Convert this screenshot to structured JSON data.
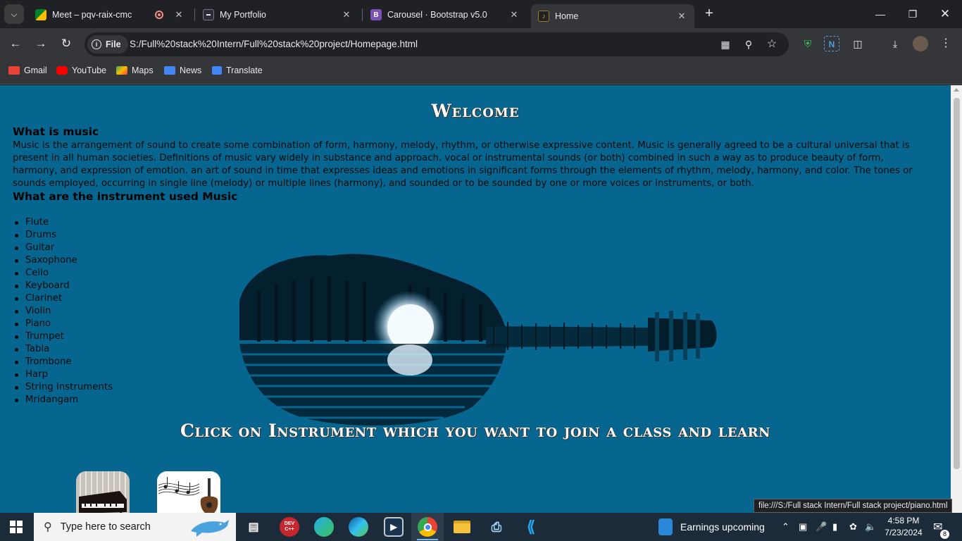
{
  "browser": {
    "tabs": [
      {
        "title": "Meet – pqv-raix-cmc",
        "favicon": "google-meet-icon",
        "recording": true
      },
      {
        "title": "My Portfolio",
        "favicon": "portfolio-icon"
      },
      {
        "title": "Carousel · Bootstrap v5.0",
        "favicon": "bootstrap-icon",
        "favicon_text": "B"
      },
      {
        "title": "Home",
        "favicon": "guitar-icon",
        "active": true
      }
    ],
    "url_chip": "File",
    "url": "S:/Full%20stack%20Intern/Full%20stack%20project/Homepage.html",
    "bookmarks": [
      {
        "label": "Gmail",
        "color": "#ea4335"
      },
      {
        "label": "YouTube",
        "color": "#ff0000"
      },
      {
        "label": "Maps",
        "color": "#34a853"
      },
      {
        "label": "News",
        "color": "#4285f4"
      },
      {
        "label": "Translate",
        "color": "#4285f4"
      }
    ],
    "status_url": "file:///S:/Full stack Intern/Full stack project/piano.html"
  },
  "page": {
    "welcome": "Welcome",
    "heading1": "What is music",
    "paragraph": "Music is the arrangement of sound to create some combination of form, harmony, melody, rhythm, or otherwise expressive content. Music is generally agreed to be a cultural universal that is present in all human societies. Definitions of music vary widely in substance and approach. vocal or instrumental sounds (or both) combined in such a way as to produce beauty of form, harmony, and expression of emotion. an art of sound in time that expresses ideas and emotions in significant forms through the elements of rhythm, melody, harmony, and color. The tones or sounds employed, occurring in single line (melody) or multiple lines (harmony), and sounded or to be sounded by one or more voices or instruments, or both.",
    "heading2": "What are the instrument used Music",
    "instruments": [
      "Flute",
      "Drums",
      "Guitar",
      "Saxophone",
      "Cello",
      "Keyboard",
      "Clarinet",
      "Violin",
      "Piano",
      "Trumpet",
      "Tabla",
      "Trombone",
      "Harp",
      "String Instruments",
      "Mridangam"
    ],
    "cta": "Click on Instrument which you want to join a class and learn",
    "background_color": "#06668f"
  },
  "taskbar": {
    "search_placeholder": "Type here to search",
    "weather": "Earnings upcoming",
    "time": "4:58 PM",
    "date": "7/23/2024",
    "notifications": "8"
  }
}
